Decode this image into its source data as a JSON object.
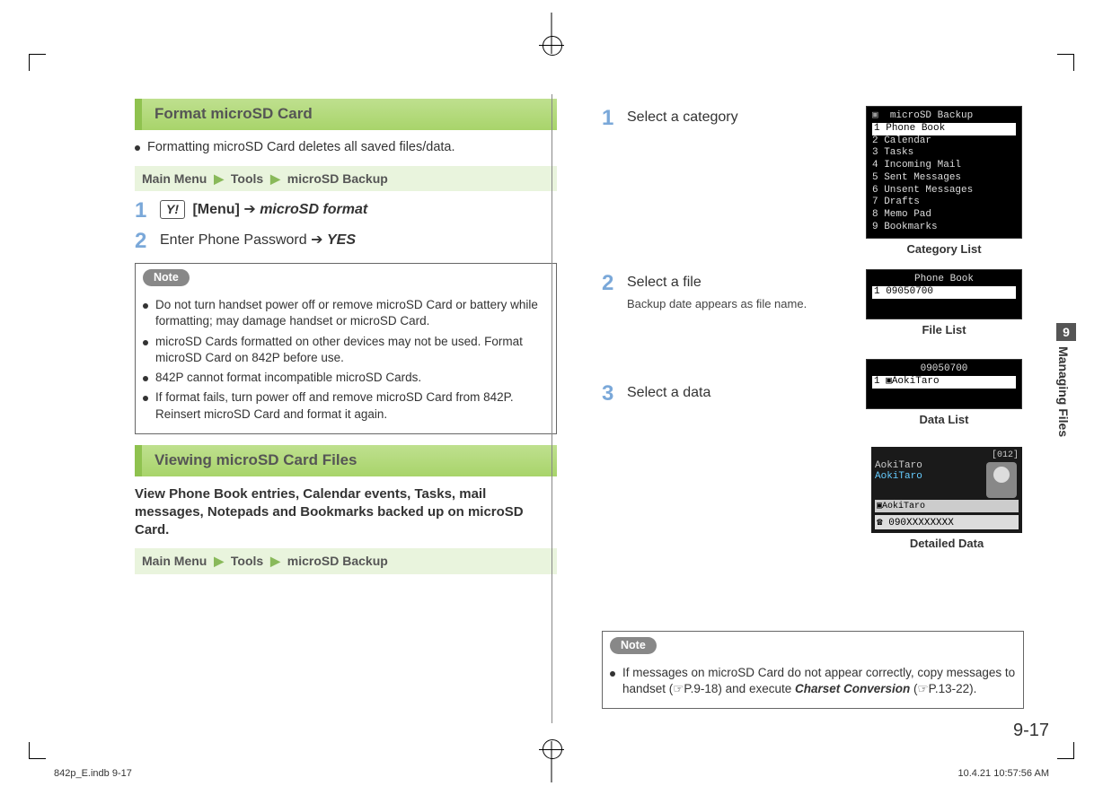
{
  "left": {
    "heading1": "Format microSD Card",
    "format_intro": "Formatting microSD Card deletes all saved files/data.",
    "menu": {
      "prefix": "Main Menu",
      "item1": "Tools",
      "item2": "microSD Backup"
    },
    "step1": {
      "key": "Y!",
      "label1": "[Menu]",
      "arrow": "➔",
      "em": "microSD format"
    },
    "step2": {
      "text": "Enter Phone Password",
      "arrow": "➔",
      "em": "YES"
    },
    "note_label": "Note",
    "note_items": [
      "Do not turn handset power off or remove microSD Card or battery while formatting; may damage handset or microSD Card.",
      "microSD Cards formatted on other devices may not be used. Format microSD Card on 842P before use.",
      "842P cannot format incompatible microSD Cards.",
      "If format fails, turn power off and remove microSD Card from 842P. Reinsert microSD Card and format it again."
    ],
    "heading2": "Viewing microSD Card Files",
    "view_intro": "View Phone Book entries, Calendar events, Tasks, mail messages, Notepads and Bookmarks backed up on microSD Card."
  },
  "right": {
    "step1": "Select a category",
    "step2": "Select a file",
    "step2_sub": "Backup date appears as file name.",
    "step3": "Select a data",
    "note_label": "Note",
    "note_text_a": "If messages on microSD Card do not appear correctly, copy messages to handset (☞P.9-18) and execute ",
    "note_em": "Charset Conversion",
    "note_text_b": " (☞P.13-22)."
  },
  "screens": {
    "cat": {
      "title": "microSD Backup",
      "items": [
        "Phone Book",
        "Calendar",
        "Tasks",
        "Incoming Mail",
        "Sent Messages",
        "Unsent Messages",
        "Drafts",
        "Memo Pad",
        "Bookmarks"
      ],
      "caption": "Category List"
    },
    "file": {
      "title": "Phone Book",
      "row": "09050700",
      "caption": "File List"
    },
    "data": {
      "title": "09050700",
      "row": "AokiTaro",
      "caption": "Data List"
    },
    "detail": {
      "tag": "[012]",
      "name1": "AokiTaro",
      "name2": "AokiTaro",
      "name3": "AokiTaro",
      "phone": "090XXXXXXXX",
      "caption": "Detailed Data"
    }
  },
  "sidetab": {
    "num": "9",
    "label": "Managing Files"
  },
  "page_number": "9-17",
  "footer": {
    "left": "842p_E.indb   9-17",
    "right": "10.4.21   10:57:56 AM"
  }
}
